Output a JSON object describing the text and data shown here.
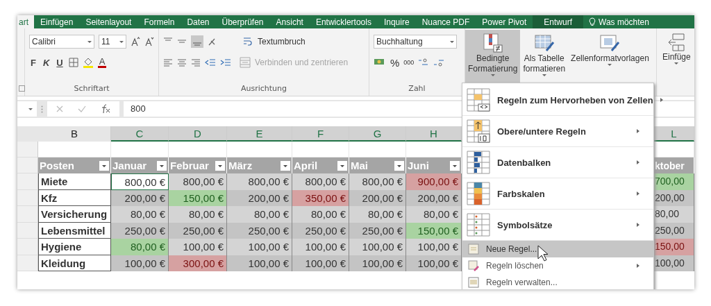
{
  "ribbon_tabs": [
    {
      "label": "art",
      "selected": true,
      "kind": "normal"
    },
    {
      "label": "Einfügen",
      "selected": false,
      "kind": "normal"
    },
    {
      "label": "Seitenlayout",
      "selected": false,
      "kind": "normal"
    },
    {
      "label": "Formeln",
      "selected": false,
      "kind": "normal"
    },
    {
      "label": "Daten",
      "selected": false,
      "kind": "normal"
    },
    {
      "label": "Überprüfen",
      "selected": false,
      "kind": "normal"
    },
    {
      "label": "Ansicht",
      "selected": false,
      "kind": "normal"
    },
    {
      "label": "Entwicklertools",
      "selected": false,
      "kind": "normal"
    },
    {
      "label": "Inquire",
      "selected": false,
      "kind": "normal"
    },
    {
      "label": "Nuance PDF",
      "selected": false,
      "kind": "normal"
    },
    {
      "label": "Power Pivot",
      "selected": false,
      "kind": "normal"
    },
    {
      "label": "Entwurf",
      "selected": false,
      "kind": "contextual"
    },
    {
      "label": "Was möchten",
      "selected": false,
      "kind": "search"
    }
  ],
  "font_group": {
    "font": "Calibri",
    "size": "11",
    "bold": "F",
    "italic": "K",
    "underline": "U",
    "font_color": "A",
    "label": "Schriftart"
  },
  "alignment_group": {
    "wrap": "Textumbruch",
    "merge": {
      "label": "Verbinden und zentrieren",
      "disabled": true
    },
    "label": "Ausrichtung"
  },
  "number_group": {
    "format": "Buchhaltung",
    "percent": "%",
    "thousands": "000",
    "label": "Zahl"
  },
  "styles_group": {
    "buttons": [
      {
        "lines": [
          "Bedingte",
          "Formatierung"
        ],
        "pressed": true,
        "kind": "conditional"
      },
      {
        "lines": [
          "Als Tabelle",
          "formatieren"
        ],
        "pressed": false,
        "kind": "table"
      },
      {
        "lines": [
          "Zellenformatvorlagen"
        ],
        "pressed": false,
        "kind": "styles"
      }
    ]
  },
  "cells_group": {
    "button": "Einfüge"
  },
  "formula_bar": {
    "value": "800"
  },
  "columns": [
    {
      "letter": "B",
      "selected": false
    },
    {
      "letter": "C",
      "selected": true
    },
    {
      "letter": "D",
      "selected": true
    },
    {
      "letter": "E",
      "selected": true
    },
    {
      "letter": "F",
      "selected": true
    },
    {
      "letter": "G",
      "selected": true
    },
    {
      "letter": "H",
      "selected": true
    },
    {
      "letter": "L",
      "selected": true
    }
  ],
  "table": {
    "headers": [
      "Posten",
      "Januar",
      "Februar",
      "März",
      "April",
      "Mai",
      "Juni",
      "ktober"
    ],
    "rows": [
      {
        "label": "Miete",
        "cells": [
          {
            "value": "800,00 €",
            "kind": "plain",
            "selected": true
          },
          {
            "value": "800,00 €",
            "kind": "plain",
            "selected": false
          },
          {
            "value": "800,00 €",
            "kind": "plain",
            "selected": false
          },
          {
            "value": "800,00 €",
            "kind": "plain",
            "selected": false
          },
          {
            "value": "800,00 €",
            "kind": "plain",
            "selected": false
          },
          {
            "value": "900,00 €",
            "kind": "bad",
            "selected": false
          },
          {
            "value": "700,00",
            "kind": "good",
            "selected": false
          }
        ]
      },
      {
        "label": "Kfz",
        "cells": [
          {
            "value": "200,00 €",
            "kind": "plain",
            "selected": false
          },
          {
            "value": "150,00 €",
            "kind": "good",
            "selected": false
          },
          {
            "value": "200,00 €",
            "kind": "plain",
            "selected": false
          },
          {
            "value": "350,00 €",
            "kind": "bad",
            "selected": false
          },
          {
            "value": "200,00 €",
            "kind": "plain",
            "selected": false
          },
          {
            "value": "200,00 €",
            "kind": "plain",
            "selected": false
          },
          {
            "value": "200,00",
            "kind": "plain",
            "selected": false
          }
        ]
      },
      {
        "label": "Versicherung",
        "cells": [
          {
            "value": "80,00 €",
            "kind": "plain",
            "selected": false
          },
          {
            "value": "80,00 €",
            "kind": "plain",
            "selected": false
          },
          {
            "value": "80,00 €",
            "kind": "plain",
            "selected": false
          },
          {
            "value": "80,00 €",
            "kind": "plain",
            "selected": false
          },
          {
            "value": "80,00 €",
            "kind": "plain",
            "selected": false
          },
          {
            "value": "80,00 €",
            "kind": "plain",
            "selected": false
          },
          {
            "value": "80,00",
            "kind": "plain",
            "selected": false
          }
        ]
      },
      {
        "label": "Lebensmittel",
        "cells": [
          {
            "value": "250,00 €",
            "kind": "plain",
            "selected": false
          },
          {
            "value": "250,00 €",
            "kind": "plain",
            "selected": false
          },
          {
            "value": "250,00 €",
            "kind": "plain",
            "selected": false
          },
          {
            "value": "250,00 €",
            "kind": "plain",
            "selected": false
          },
          {
            "value": "250,00 €",
            "kind": "plain",
            "selected": false
          },
          {
            "value": "150,00 €",
            "kind": "good",
            "selected": false
          },
          {
            "value": "250,00",
            "kind": "plain",
            "selected": false
          }
        ]
      },
      {
        "label": "Hygiene",
        "cells": [
          {
            "value": "80,00 €",
            "kind": "good",
            "selected": false
          },
          {
            "value": "100,00 €",
            "kind": "plain",
            "selected": false
          },
          {
            "value": "100,00 €",
            "kind": "plain",
            "selected": false
          },
          {
            "value": "100,00 €",
            "kind": "plain",
            "selected": false
          },
          {
            "value": "100,00 €",
            "kind": "plain",
            "selected": false
          },
          {
            "value": "100,00 €",
            "kind": "plain",
            "selected": false
          },
          {
            "value": "150,00",
            "kind": "bad",
            "selected": false
          }
        ]
      },
      {
        "label": "Kleidung",
        "cells": [
          {
            "value": "100,00 €",
            "kind": "plain",
            "selected": false
          },
          {
            "value": "300,00 €",
            "kind": "bad",
            "selected": false
          },
          {
            "value": "100,00 €",
            "kind": "plain",
            "selected": false
          },
          {
            "value": "100,00 €",
            "kind": "plain",
            "selected": false
          },
          {
            "value": "100,00 €",
            "kind": "plain",
            "selected": false
          },
          {
            "value": "100,00 €",
            "kind": "plain",
            "selected": false
          },
          {
            "value": "100,00",
            "kind": "plain",
            "selected": false
          }
        ]
      }
    ]
  },
  "menu": {
    "items": [
      {
        "label": "Regeln zum Hervorheben von Zellen",
        "kind": "highlight",
        "submenu": true,
        "selected": false
      },
      {
        "label": "Obere/untere Regeln",
        "kind": "topbottom",
        "submenu": true,
        "selected": false
      },
      {
        "label": "Datenbalken",
        "kind": "databars",
        "submenu": true,
        "selected": false
      },
      {
        "label": "Farbskalen",
        "kind": "colorscales",
        "submenu": true,
        "selected": false
      },
      {
        "label": "Symbolsätze",
        "kind": "iconsets",
        "submenu": true,
        "selected": false
      },
      {
        "label": "Neue Regel...",
        "kind": "new",
        "submenu": false,
        "selected": true
      },
      {
        "label": "Regeln löschen",
        "kind": "clear",
        "submenu": true,
        "selected": false
      },
      {
        "label": "Regeln verwalten...",
        "kind": "manage",
        "submenu": false,
        "selected": false
      }
    ]
  }
}
